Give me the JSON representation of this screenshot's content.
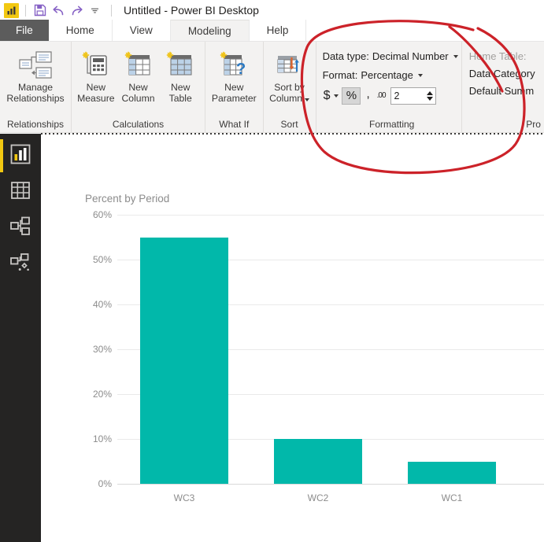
{
  "titlebar": {
    "app_icon": "power-bi-logo-icon",
    "save_icon": "save-icon",
    "undo_icon": "undo-icon",
    "redo_icon": "redo-icon",
    "customize_icon": "chevron-down-icon",
    "title": "Untitled - Power BI Desktop"
  },
  "tabs": [
    {
      "label": "File",
      "active": false,
      "is_file": true
    },
    {
      "label": "Home",
      "active": false,
      "is_file": false
    },
    {
      "label": "View",
      "active": false,
      "is_file": false
    },
    {
      "label": "Modeling",
      "active": true,
      "is_file": false
    },
    {
      "label": "Help",
      "active": false,
      "is_file": false
    }
  ],
  "ribbon": {
    "groups": [
      {
        "name": "relationships",
        "label": "Relationships",
        "buttons": [
          {
            "line1": "Manage",
            "line2": "Relationships",
            "icon": "manage-relationships-icon"
          }
        ]
      },
      {
        "name": "calculations",
        "label": "Calculations",
        "buttons": [
          {
            "line1": "New",
            "line2": "Measure",
            "icon": "new-measure-icon"
          },
          {
            "line1": "New",
            "line2": "Column",
            "icon": "new-column-icon"
          },
          {
            "line1": "New",
            "line2": "Table",
            "icon": "new-table-icon"
          }
        ]
      },
      {
        "name": "what-if",
        "label": "What If",
        "buttons": [
          {
            "line1": "New",
            "line2": "Parameter",
            "icon": "new-parameter-icon"
          }
        ]
      },
      {
        "name": "sort",
        "label": "Sort",
        "buttons": [
          {
            "line1": "Sort by",
            "line2": "Column",
            "icon": "sort-by-column-icon",
            "has_caret": true
          }
        ]
      }
    ],
    "formatting": {
      "label": "Formatting",
      "data_type_label": "Data type:",
      "data_type_value": "Decimal Number",
      "format_label": "Format:",
      "format_value": "Percentage",
      "currency_symbol": "$",
      "percent_symbol": "%",
      "thousands_symbol": ",",
      "decimal_icon_label": ".00",
      "decimal_places": "2",
      "percent_selected": true
    },
    "properties": {
      "label": "Pro",
      "home_table_label": "Home Table:",
      "data_category_label": "Data Category",
      "default_summarization_label": "Default Summ"
    }
  },
  "sidebar": {
    "items": [
      {
        "name": "report-view",
        "icon": "bar-chart-icon",
        "active": true
      },
      {
        "name": "data-view",
        "icon": "table-grid-icon",
        "active": false
      },
      {
        "name": "model-view",
        "icon": "relationships-icon",
        "active": false
      },
      {
        "name": "dax-query-view",
        "icon": "dax-query-icon",
        "active": false
      }
    ]
  },
  "chart_data": {
    "type": "bar",
    "title": "Percent by Period",
    "categories": [
      "WC3",
      "WC2",
      "WC1"
    ],
    "values": [
      55,
      10,
      5
    ],
    "xlabel": "",
    "ylabel": "",
    "ylim": [
      0,
      60
    ],
    "yticks": [
      60,
      50,
      40,
      30,
      20,
      10,
      0
    ],
    "ytick_labels": [
      "60%",
      "50%",
      "40%",
      "30%",
      "20%",
      "10%",
      "0%"
    ],
    "bar_color": "#01b8aa",
    "grid": true,
    "legend": false
  },
  "annotation": {
    "name": "red-circle-annotation",
    "color": "#cc2229",
    "target": "Formatting"
  }
}
